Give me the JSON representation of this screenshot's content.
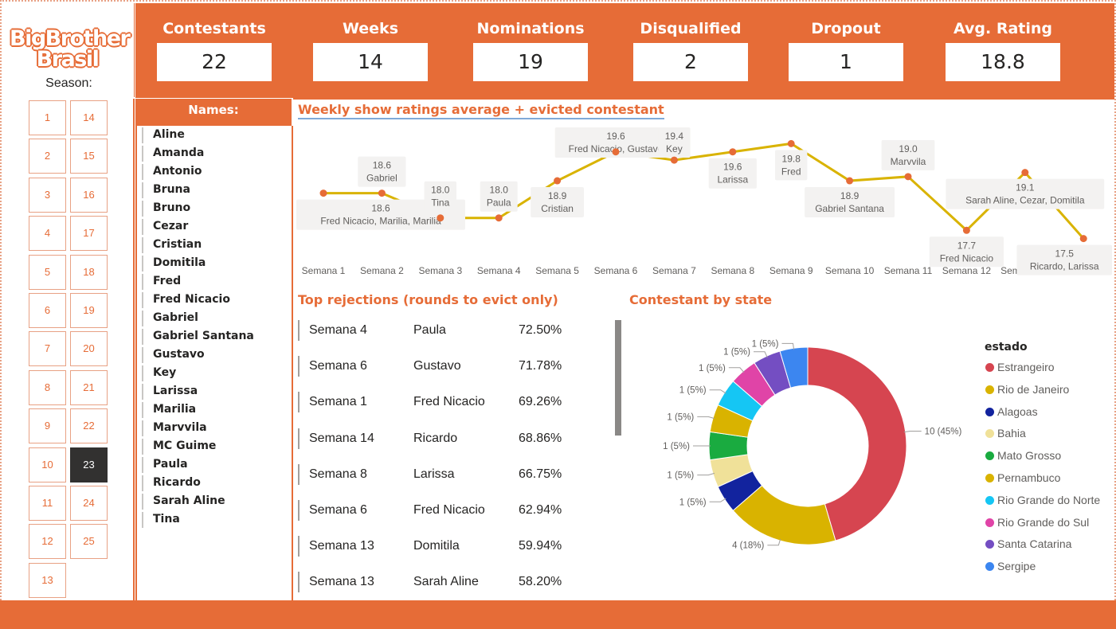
{
  "logo": {
    "line1": "BigBrother",
    "line2": "Brasil"
  },
  "season_label": "Season:",
  "seasons": [
    "1",
    "14",
    "2",
    "15",
    "3",
    "16",
    "4",
    "17",
    "5",
    "18",
    "6",
    "19",
    "7",
    "20",
    "8",
    "21",
    "9",
    "22",
    "10",
    "23",
    "11",
    "24",
    "12",
    "25",
    "13"
  ],
  "selected_season": "23",
  "kpis": [
    {
      "label": "Contestants",
      "value": "22"
    },
    {
      "label": "Weeks",
      "value": "14"
    },
    {
      "label": "Nominations",
      "value": "19"
    },
    {
      "label": "Disqualified",
      "value": "2"
    },
    {
      "label": "Dropout",
      "value": "1"
    },
    {
      "label": "Avg. Rating",
      "value": "18.8"
    }
  ],
  "names": {
    "header": "Names:",
    "items": [
      "Aline",
      "Amanda",
      "Antonio",
      "Bruna",
      "Bruno",
      "Cezar",
      "Cristian",
      "Domitila",
      "Fred",
      "Fred Nicacio",
      "Gabriel",
      "Gabriel Santana",
      "Gustavo",
      "Key",
      "Larissa",
      "Marilia",
      "Marvvila",
      "MC Guime",
      "Paula",
      "Ricardo",
      "Sarah Aline",
      "Tina"
    ]
  },
  "line_chart": {
    "title": "Weekly show ratings average + evicted contestant",
    "line_color": "#d9b300",
    "point_color": "#e66c37"
  },
  "rejections": {
    "title": "Top rejections (rounds to evict only)",
    "rows": [
      {
        "week": "Semana 4",
        "name": "Paula",
        "pct": "72.50%"
      },
      {
        "week": "Semana 6",
        "name": "Gustavo",
        "pct": "71.78%"
      },
      {
        "week": "Semana 1",
        "name": "Fred Nicacio",
        "pct": "69.26%"
      },
      {
        "week": "Semana 14",
        "name": "Ricardo",
        "pct": "68.86%"
      },
      {
        "week": "Semana 8",
        "name": "Larissa",
        "pct": "66.75%"
      },
      {
        "week": "Semana 6",
        "name": "Fred Nicacio",
        "pct": "62.94%"
      },
      {
        "week": "Semana 13",
        "name": "Domitila",
        "pct": "59.94%"
      },
      {
        "week": "Semana 13",
        "name": "Sarah Aline",
        "pct": "58.20%"
      }
    ]
  },
  "donut": {
    "title": "Contestant by state",
    "legend_title": "estado"
  },
  "chart_data": [
    {
      "type": "line",
      "title": "Weekly show ratings average + evicted contestant",
      "x": [
        "Semana 1",
        "Semana 2",
        "Semana 3",
        "Semana 4",
        "Semana 5",
        "Semana 6",
        "Semana 7",
        "Semana 8",
        "Semana 9",
        "Semana 10",
        "Semana 11",
        "Semana 12",
        "Semana 13",
        "Semana 14"
      ],
      "values": [
        18.6,
        18.6,
        18.0,
        18.0,
        18.9,
        19.6,
        19.4,
        19.6,
        19.8,
        18.9,
        19.0,
        17.7,
        19.1,
        17.5
      ],
      "labels": [
        "18.6",
        "18.6",
        "18.0",
        "18.0",
        "18.9",
        "19.6",
        "19.4",
        "19.6",
        "19.8",
        "18.9",
        "19.0",
        "17.7",
        "19.1",
        "17.5"
      ],
      "evicted": [
        "Fred Nicacio, Marilia, Marilia",
        "Gabriel",
        "Tina",
        "Paula",
        "Cristian",
        "Fred Nicacio, Gustavo",
        "Key",
        "Larissa",
        "Fred",
        "Gabriel Santana",
        "Marvvila",
        "Fred Nicacio",
        "Sarah Aline, Cezar, Domitila",
        "Ricardo, Larissa"
      ],
      "grid": false
    },
    {
      "type": "pie",
      "title": "Contestant by state",
      "legend_title": "estado",
      "legend_position": "right",
      "categories": [
        "Estrangeiro",
        "Rio de Janeiro",
        "Alagoas",
        "Bahia",
        "Mato Grosso",
        "Pernambuco",
        "Rio Grande do Norte",
        "Rio Grande do Sul",
        "Santa Catarina",
        "Sergipe"
      ],
      "values": [
        10,
        4,
        1,
        1,
        1,
        1,
        1,
        1,
        1,
        1
      ],
      "labels": [
        "10 (45%)",
        "4 (18%)",
        "1 (5%)",
        "1 (5%)",
        "1 (5%)",
        "1 (5%)",
        "1 (5%)",
        "1 (5%)",
        "1 (5%)",
        "1 (5%)"
      ],
      "colors": [
        "#d64550",
        "#d9b300",
        "#12239e",
        "#f0e199",
        "#1aab40",
        "#d9b300",
        "#15c6f4",
        "#e044a7",
        "#744ec2",
        "#3c86f0"
      ]
    }
  ]
}
